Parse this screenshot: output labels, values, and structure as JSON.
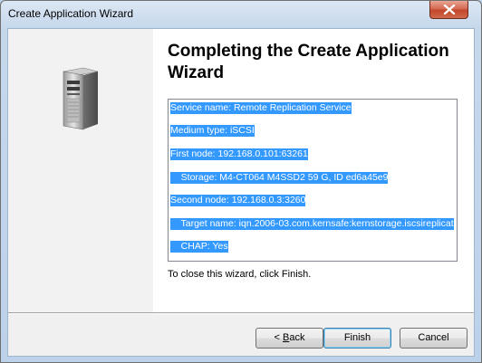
{
  "window": {
    "title": "Create Application Wizard"
  },
  "heading": "Completing the Create Application Wizard",
  "summary_lines": [
    "Service name: Remote Replication Service",
    "Medium type: iSCSI",
    "First node: 192.168.0.101:63261",
    "    Storage: M4-CT064 M4SSD2 59 G, ID ed6a45e9",
    "Second node: 192.168.0.3:3260",
    "    Target name: iqn.2006-03.com.kernsafe:kernstorage.iscsireplicat",
    "    CHAP: Yes"
  ],
  "close_note": "To close this wizard, click Finish.",
  "buttons": {
    "back_prefix": "< ",
    "back_mnemonic": "B",
    "back_rest": "ack",
    "finish": "Finish",
    "cancel": "Cancel"
  },
  "icons": {
    "close": "close-icon",
    "server": "server-icon"
  },
  "colors": {
    "selection": "#3399ff",
    "close_button": "#c3462b"
  }
}
